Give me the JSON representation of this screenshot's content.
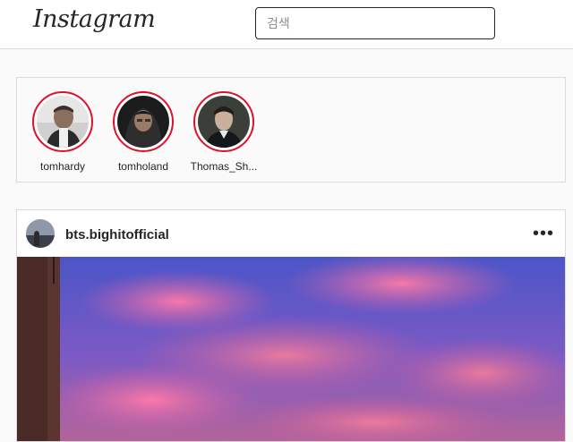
{
  "header": {
    "logo_text": "Instagram",
    "search_placeholder": "검색"
  },
  "stories": [
    {
      "username": "tomhardy",
      "avatar_icon": "profile-photo"
    },
    {
      "username": "tomholand",
      "avatar_icon": "profile-photo"
    },
    {
      "username": "Thomas_Sh...",
      "avatar_icon": "profile-photo"
    }
  ],
  "post": {
    "username": "bts.bighitofficial",
    "more_icon": "ellipsis-icon",
    "more_glyph": "•••",
    "image_subject": "sunset-sky-photo"
  },
  "colors": {
    "story_ring": "#e0102a",
    "border": "#dbdbdb",
    "background": "#fafafa"
  }
}
